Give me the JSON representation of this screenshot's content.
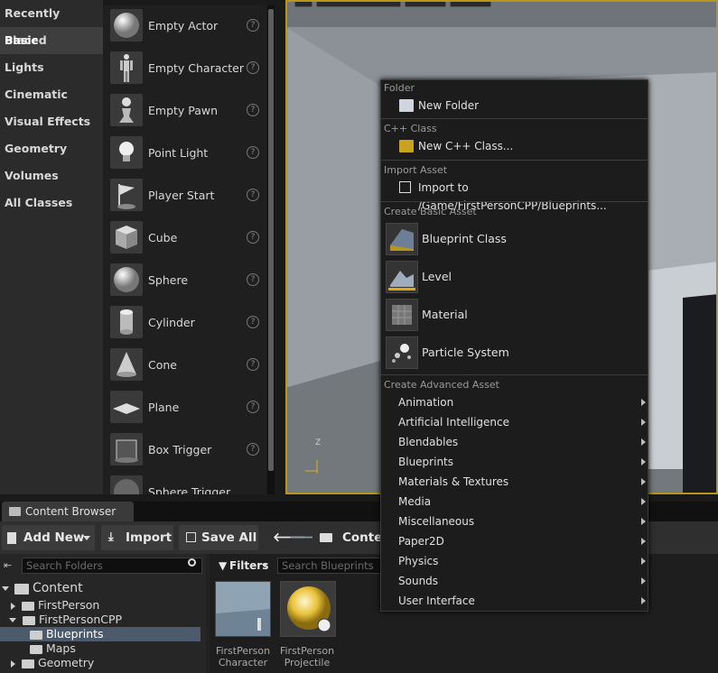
{
  "place_actors": {
    "categories": [
      "Recently Placed",
      "Basic",
      "Lights",
      "Cinematic",
      "Visual Effects",
      "Geometry",
      "Volumes",
      "All Classes"
    ],
    "active_category": "Basic",
    "items": [
      {
        "label": "Empty Actor",
        "icon": "sphere-icon"
      },
      {
        "label": "Empty Character",
        "icon": "mannequin-icon"
      },
      {
        "label": "Empty Pawn",
        "icon": "pawn-icon"
      },
      {
        "label": "Point Light",
        "icon": "lightbulb-icon"
      },
      {
        "label": "Player Start",
        "icon": "flag-icon"
      },
      {
        "label": "Cube",
        "icon": "cube-icon"
      },
      {
        "label": "Sphere",
        "icon": "sphere-icon"
      },
      {
        "label": "Cylinder",
        "icon": "cylinder-icon"
      },
      {
        "label": "Cone",
        "icon": "cone-icon"
      },
      {
        "label": "Plane",
        "icon": "plane-icon"
      },
      {
        "label": "Box Trigger",
        "icon": "box-trigger-icon"
      },
      {
        "label": "Sphere Trigger",
        "icon": "sphere-trigger-icon"
      }
    ],
    "help_glyph": "?"
  },
  "viewport": {
    "axis_label": "Z"
  },
  "content_browser": {
    "tab_label": "Content Browser",
    "toolbar": {
      "add_new": "Add New",
      "import": "Import",
      "save_all": "Save All",
      "path_crumb": "Conter"
    },
    "search_folders_placeholder": "Search Folders",
    "filters_label": "Filters",
    "search_assets_placeholder": "Search Blueprints",
    "tree": {
      "root": "Content",
      "items": [
        "FirstPerson",
        "FirstPersonCPP",
        "Blueprints",
        "Maps",
        "Geometry"
      ]
    },
    "assets": [
      {
        "line1": "FirstPerson",
        "line2": "Character"
      },
      {
        "line1": "FirstPerson",
        "line2": "Projectile"
      }
    ]
  },
  "context_menu": {
    "folder_header": "Folder",
    "new_folder": "New Folder",
    "cpp_header": "C++ Class",
    "new_cpp": "New C++ Class...",
    "import_header": "Import Asset",
    "import_to": "Import to /Game/FirstPersonCPP/Blueprints...",
    "basic_header": "Create Basic Asset",
    "basic_items": [
      "Blueprint Class",
      "Level",
      "Material",
      "Particle System"
    ],
    "advanced_header": "Create Advanced Asset",
    "advanced_items": [
      "Animation",
      "Artificial Intelligence",
      "Blendables",
      "Blueprints",
      "Materials & Textures",
      "Media",
      "Miscellaneous",
      "Paper2D",
      "Physics",
      "Sounds",
      "User Interface"
    ]
  },
  "colors": {
    "viewport_border": "#b8951d",
    "selection": "#4d5a6b",
    "menu_bg": "#1c1c1c"
  }
}
